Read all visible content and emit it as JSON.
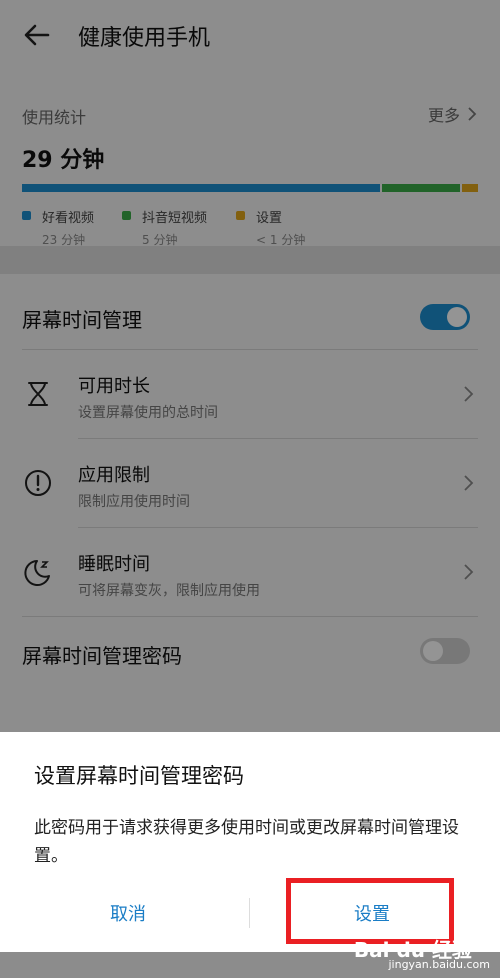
{
  "header": {
    "title": "健康使用手机"
  },
  "stats": {
    "label": "使用统计",
    "more": "更多",
    "total": "29 分钟",
    "apps": [
      {
        "name": "好看视频",
        "time": "23 分钟",
        "minutes": 23,
        "color": "#1c8ecf"
      },
      {
        "name": "抖音短视频",
        "time": "5 分钟",
        "minutes": 5,
        "color": "#3aab48"
      },
      {
        "name": "设置",
        "time": "< 1 分钟",
        "minutes": 1,
        "color": "#e0a51a"
      }
    ]
  },
  "screen_time": {
    "label": "屏幕时间管理",
    "enabled": true,
    "items": [
      {
        "name": "可用时长",
        "desc": "设置屏幕使用的总时间",
        "icon": "hourglass-icon"
      },
      {
        "name": "应用限制",
        "desc": "限制应用使用时间",
        "icon": "alert-circle-icon"
      },
      {
        "name": "睡眠时间",
        "desc": "可将屏幕变灰，限制应用使用",
        "icon": "moon-sleep-icon"
      }
    ],
    "password": {
      "label": "屏幕时间管理密码",
      "enabled": false
    }
  },
  "colors": {
    "accent": "#1c8ecf",
    "dialog_button": "#1a7dc6",
    "highlight": "#ea1f23"
  },
  "dialog": {
    "title": "设置屏幕时间管理密码",
    "message": "此密码用于请求获得更多使用时间或更改屏幕时间管理设置。",
    "cancel": "取消",
    "confirm": "设置"
  },
  "watermark": {
    "text": "Bai du 经验",
    "url": "jingyan.baidu.com"
  }
}
